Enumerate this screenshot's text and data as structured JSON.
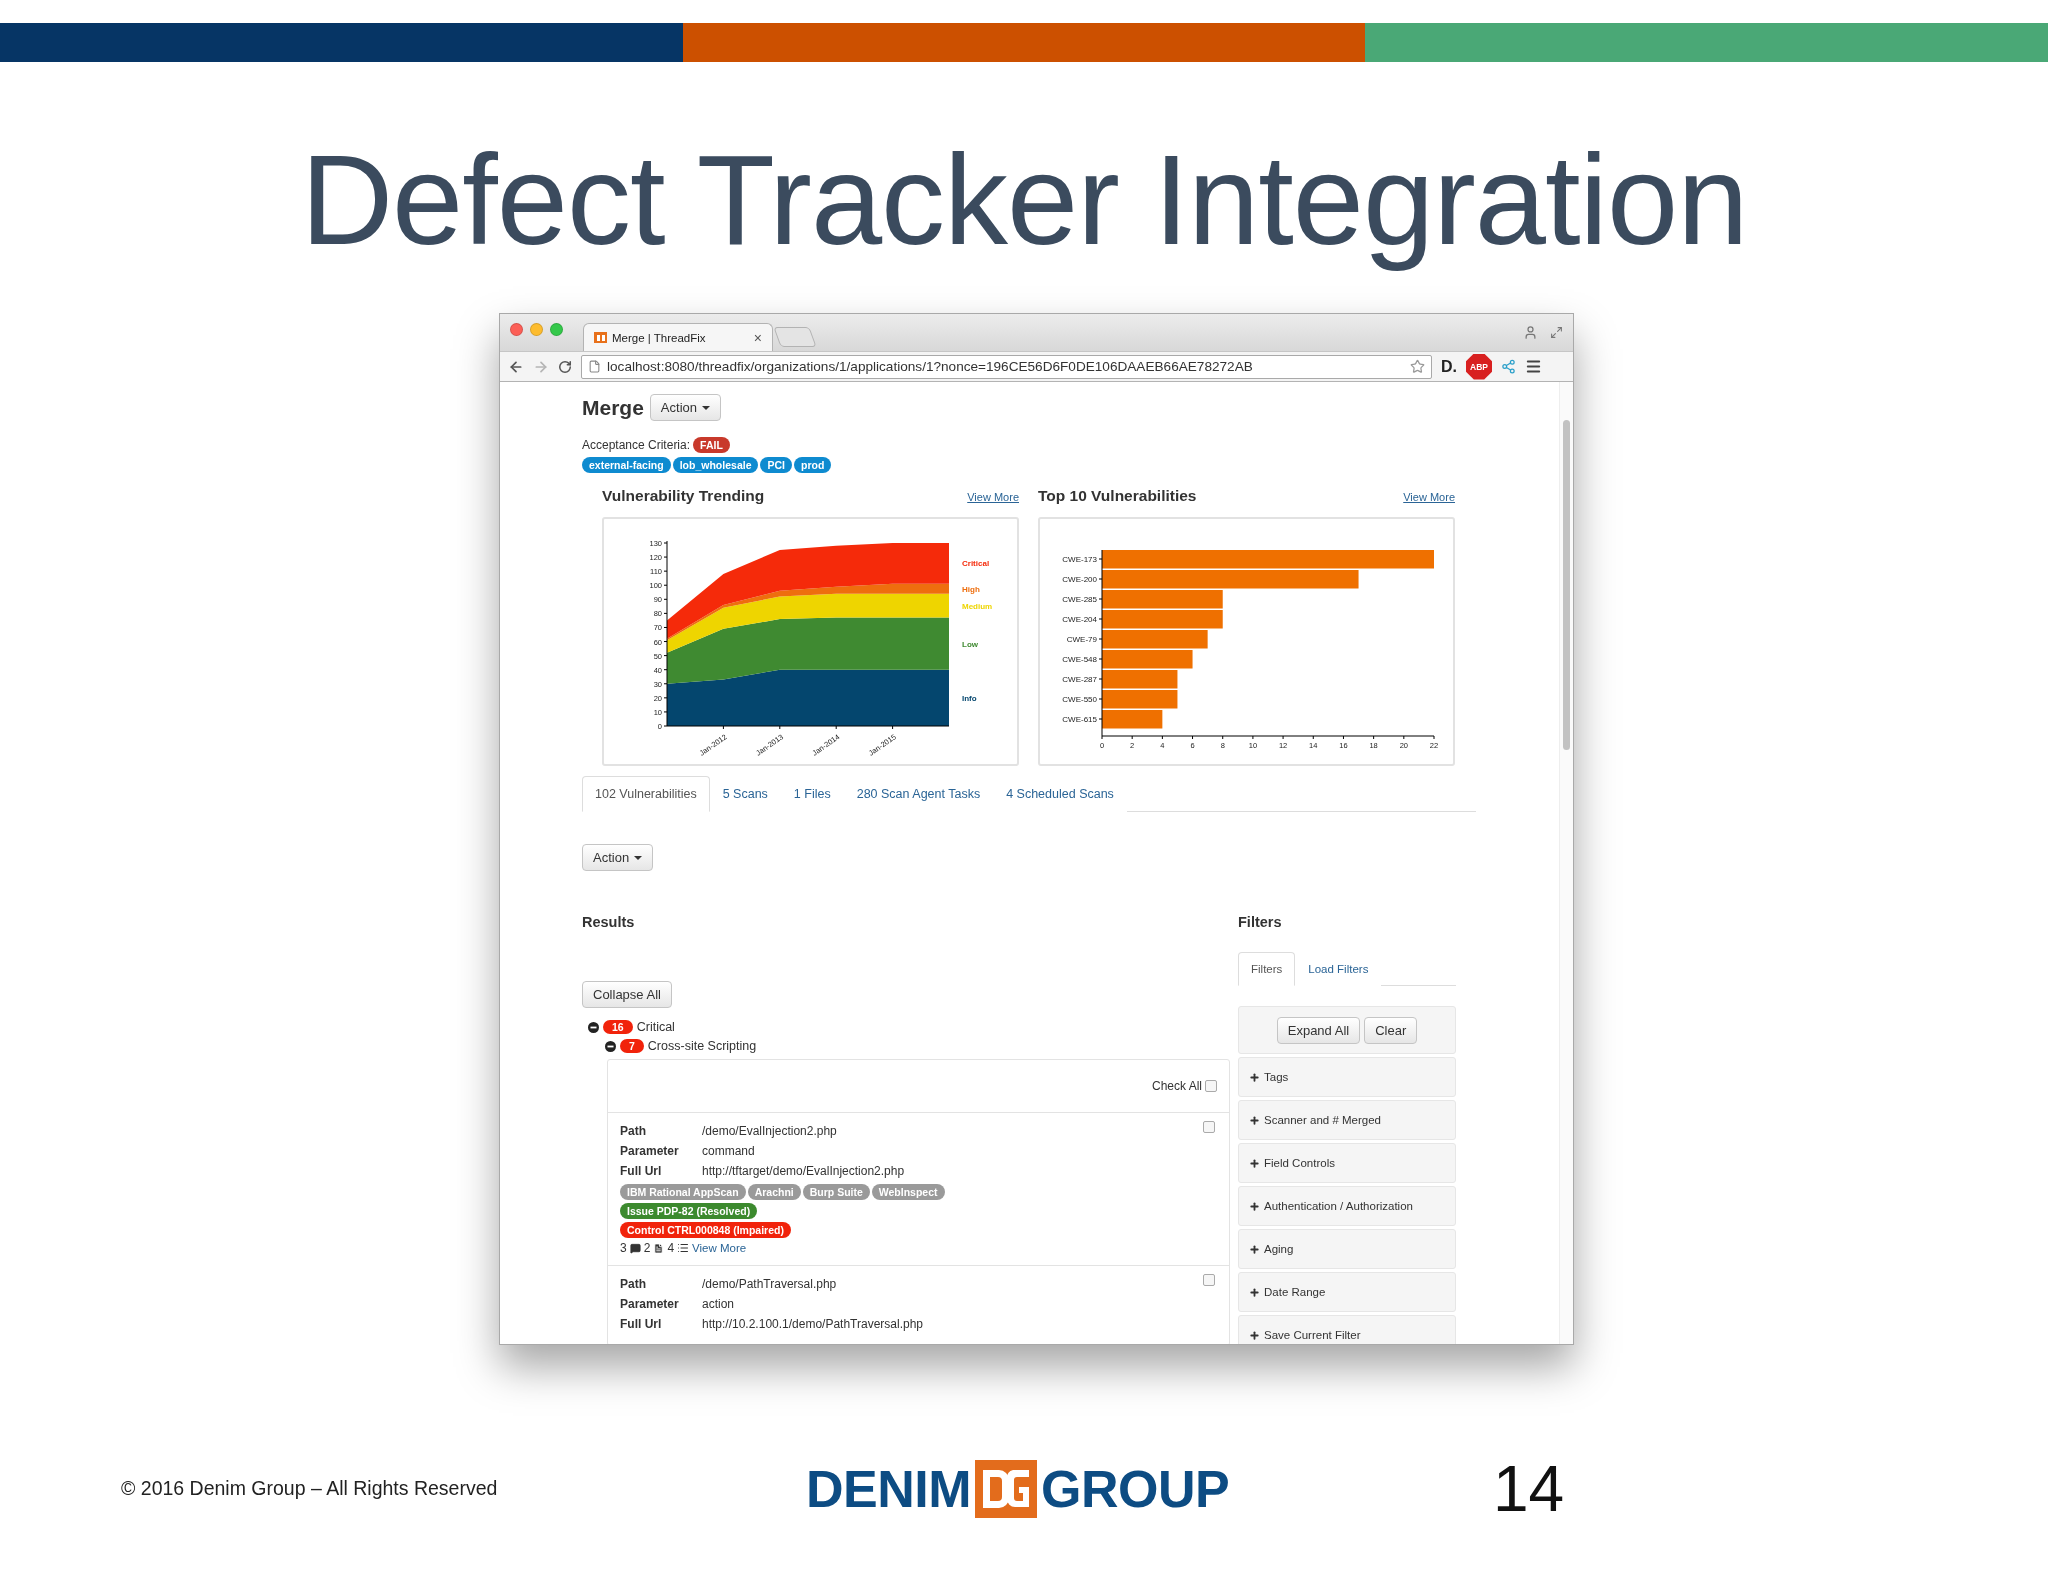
{
  "slide": {
    "title": "Defect Tracker Integration"
  },
  "browser": {
    "tab_title": "Merge | ThreadFix",
    "tab_close": "×",
    "url": "localhost:8080/threadfix/organizations/1/applications/1?nonce=196CE56D6F0DE106DAAEB66AE78272AB",
    "extension_label": "D.",
    "adblock_label": "ABP"
  },
  "page": {
    "title": "Merge",
    "action_label": "Action",
    "acceptance": {
      "label": "Acceptance Criteria:",
      "status": "FAIL"
    },
    "tags": [
      "external-facing",
      "lob_wholesale",
      "PCI",
      "prod"
    ],
    "charts": [
      {
        "heading": "Vulnerability Trending",
        "link": "View More",
        "chart_data": {
          "type": "area",
          "stacked": true,
          "categories": [
            null,
            "Jan-2012",
            "Jan-2013",
            "Jan-2014",
            "Jan-2015",
            null
          ],
          "ylim": [
            0,
            130
          ],
          "yticks": [
            0,
            10,
            20,
            30,
            40,
            50,
            60,
            70,
            80,
            90,
            100,
            110,
            120,
            130
          ],
          "series": [
            {
              "name": "Info",
              "color": "#04466e",
              "values": [
                30,
                33,
                40,
                40,
                40,
                40
              ]
            },
            {
              "name": "Low",
              "color": "#3f8a31",
              "values": [
                22,
                36,
                36,
                37,
                37,
                37
              ]
            },
            {
              "name": "Medium",
              "color": "#eed500",
              "values": [
                9,
                15,
                16,
                17,
                17,
                17
              ]
            },
            {
              "name": "High",
              "color": "#ee6e0e",
              "values": [
                1,
                2,
                4,
                5,
                7,
                7
              ]
            },
            {
              "name": "Critical",
              "color": "#f52a0a",
              "values": [
                13,
                22,
                29,
                29,
                29,
                29
              ]
            }
          ]
        }
      },
      {
        "heading": "Top 10 Vulnerabilities",
        "link": "View More",
        "chart_data": {
          "type": "bar",
          "orientation": "horizontal",
          "categories": [
            "CWE-173",
            "CWE-200",
            "CWE-285",
            "CWE-204",
            "CWE-79",
            "CWE-548",
            "CWE-287",
            "CWE-550",
            "CWE-615"
          ],
          "series": [
            {
              "color": "#ef7000",
              "values": [
                22,
                17,
                8,
                8,
                7,
                6,
                5,
                5,
                4
              ]
            }
          ],
          "xlim": [
            0,
            22
          ],
          "xticks": [
            0,
            2,
            4,
            6,
            8,
            10,
            12,
            14,
            16,
            18,
            20,
            22
          ]
        }
      }
    ],
    "tabs": [
      {
        "label": "102 Vulnerabilities",
        "selected": true
      },
      {
        "label": "5 Scans",
        "selected": false
      },
      {
        "label": "1 Files",
        "selected": false
      },
      {
        "label": "280 Scan Agent Tasks",
        "selected": false
      },
      {
        "label": "4 Scheduled Scans",
        "selected": false
      }
    ],
    "action_label_2": "Action",
    "results": {
      "heading": "Results",
      "collapse_label": "Collapse All",
      "groups": [
        {
          "count": "16",
          "label": "Critical",
          "expanded": true,
          "children": [
            {
              "count": "7",
              "label": "Cross-site Scripting",
              "expanded": true
            }
          ]
        }
      ],
      "check_all": {
        "label": "Check All",
        "checked": false
      },
      "findings": [
        {
          "checked": false,
          "fields": [
            {
              "label": "Path",
              "value": "/demo/EvalInjection2.php"
            },
            {
              "label": "Parameter",
              "value": "command"
            },
            {
              "label": "Full Url",
              "value": "http://tftarget/demo/EvalInjection2.php"
            }
          ],
          "scanners": [
            "IBM Rational AppScan",
            "Arachni",
            "Burp Suite",
            "WebInspect"
          ],
          "badges": [
            {
              "kind": "issue",
              "text": "Issue PDP-82 (Resolved)"
            },
            {
              "kind": "control",
              "text": "Control CTRL000848 (Impaired)"
            }
          ],
          "counts": [
            {
              "kind": "comments",
              "value": "3"
            },
            {
              "kind": "files",
              "value": "2"
            },
            {
              "kind": "list",
              "value": "4"
            }
          ],
          "link": "View More"
        },
        {
          "checked": false,
          "fields": [
            {
              "label": "Path",
              "value": "/demo/PathTraversal.php"
            },
            {
              "label": "Parameter",
              "value": "action"
            },
            {
              "label": "Full Url",
              "value": "http://10.2.100.1/demo/PathTraversal.php"
            }
          ]
        }
      ]
    },
    "filters": {
      "heading": "Filters",
      "tabs": [
        {
          "label": "Filters",
          "selected": true
        },
        {
          "label": "Load Filters",
          "selected": false
        }
      ],
      "buttons": [
        "Expand All",
        "Clear"
      ],
      "sections": [
        {
          "label": "Tags",
          "expanded": false
        },
        {
          "label": "Scanner and # Merged",
          "expanded": false
        },
        {
          "label": "Field Controls",
          "expanded": false
        },
        {
          "label": "Authentication / Authorization",
          "expanded": false
        },
        {
          "label": "Aging",
          "expanded": false
        },
        {
          "label": "Date Range",
          "expanded": false
        },
        {
          "label": "Save Current Filter",
          "expanded": false
        }
      ]
    }
  },
  "footer": {
    "copyright": "© 2016 Denim Group – All Rights Reserved",
    "logo_left": "DENIM",
    "logo_right": "GROUP",
    "page_number": "14"
  }
}
